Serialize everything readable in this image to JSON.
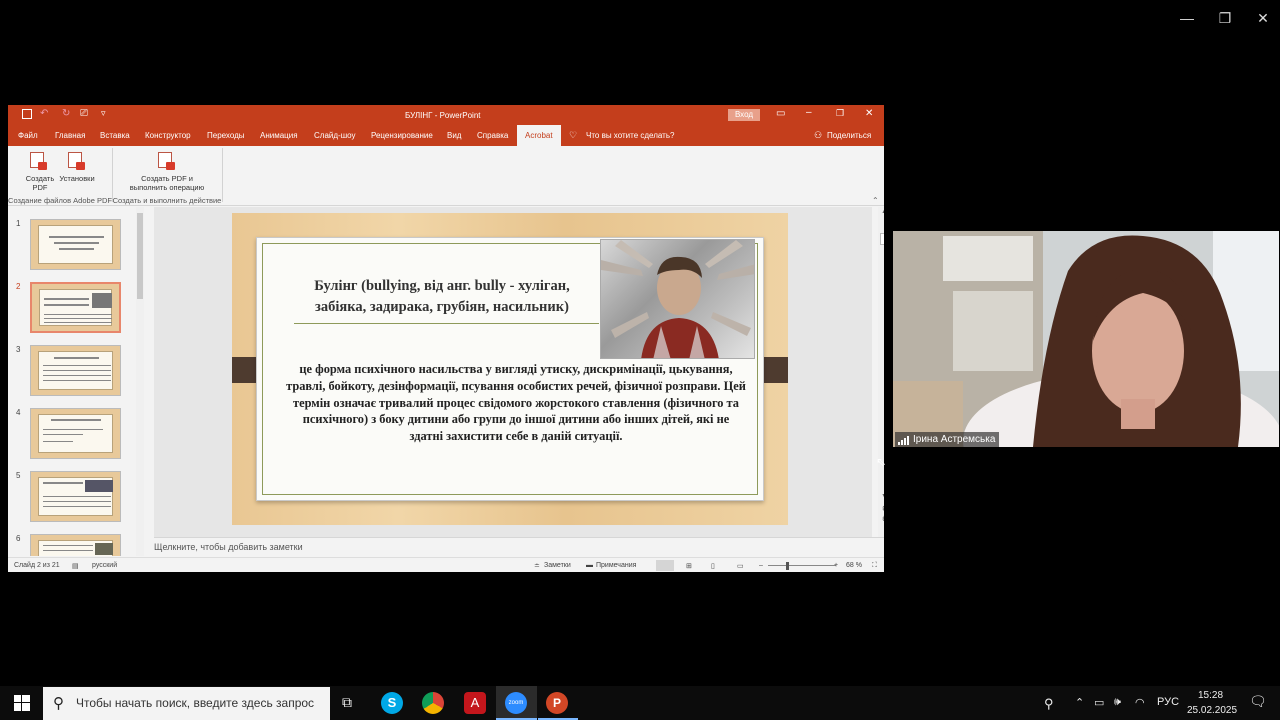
{
  "window": {
    "minimize_glyph": "—",
    "maximize_glyph": "❐",
    "close_glyph": "✕"
  },
  "ppt": {
    "title": "БУЛІНГ  -  PowerPoint",
    "signin": "Вход",
    "tabs": [
      "Файл",
      "Главная",
      "Вставка",
      "Конструктор",
      "Переходы",
      "Анимация",
      "Слайд-шоу",
      "Рецензирование",
      "Вид",
      "Справка",
      "Acrobat"
    ],
    "active_tab": "Acrobat",
    "tell_me": "Что вы хотите сделать?",
    "share": "Поделиться",
    "ribbon": {
      "create_pdf": "Создать PDF",
      "settings": "Установки",
      "create_pdf_op": "Создать PDF и выполнить операцию",
      "group1": "Создание файлов Adobe PDF",
      "group2": "Создать и выполнить действие"
    },
    "thumb_numbers": [
      "1",
      "2",
      "3",
      "4",
      "5",
      "6"
    ],
    "slide": {
      "title": "Булінг (bullying, від анг. bully - хуліган, забіяка, задирака, грубіян, насильник)",
      "body": "це форма психічного насильства у вигляді утиску, дискримінації, цькування, травлі, бойкоту, дезінформації, псування особистих речей, фізичної розправи. Цей термін означає тривалий процес свідомого жорстокого ставлення (фізичного та психічного) з боку дитини або групи до іншої дитини або інших дітей, які не здатні захистити себе в даній ситуації."
    },
    "notes_placeholder": "Щелкните, чтобы добавить заметки",
    "status": {
      "slide_of": "Слайд 2 из 21",
      "language": "русский",
      "notes": "Заметки",
      "comments": "Примечания",
      "zoom": "68 %"
    }
  },
  "zoom": {
    "participant_name": "Ірина Астремська"
  },
  "taskbar": {
    "search_placeholder": "Чтобы начать поиск, введите здесь запрос",
    "language": "РУС",
    "time": "15:28",
    "date": "25.02.2025"
  }
}
